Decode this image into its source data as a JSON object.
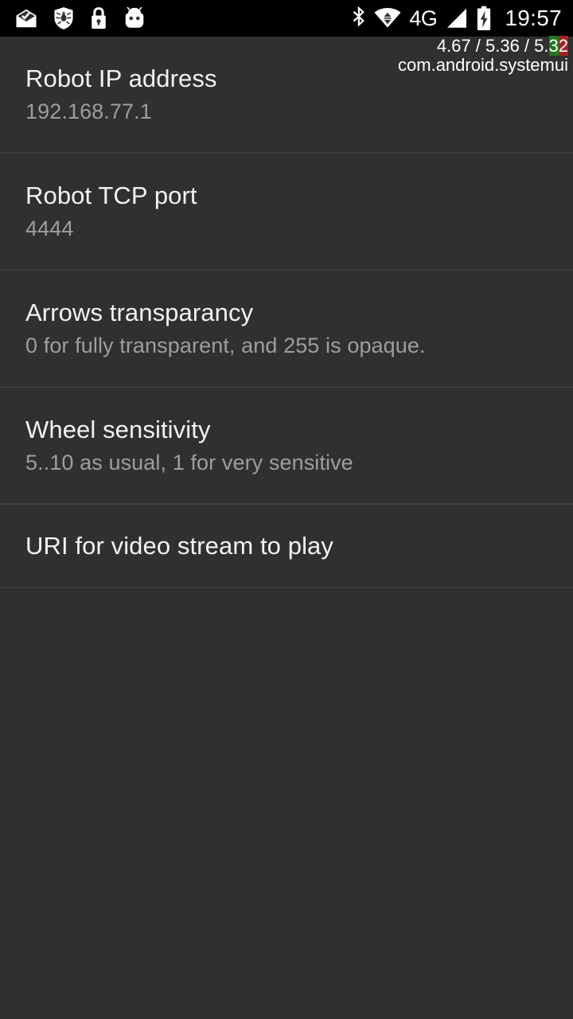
{
  "statusbar": {
    "left_icons": [
      {
        "name": "email-inbox-icon",
        "label": "Email"
      },
      {
        "name": "shield-antivirus-icon",
        "label": "Dr.Web antivirus"
      },
      {
        "name": "lock-icon",
        "label": "Screen lock"
      },
      {
        "name": "android-head-icon",
        "label": "Android"
      }
    ],
    "right_icons": [
      {
        "name": "bluetooth-icon",
        "label": "Bluetooth"
      },
      {
        "name": "wifi-icon",
        "label": "Wi-Fi"
      }
    ],
    "network_type": "4G",
    "signal_icon": "signal-bars-icon",
    "battery_icon": "battery-charging-icon",
    "clock": "19:57"
  },
  "overlay": {
    "load_prefix": "4.67 / 5.36 / 5.",
    "load_green": "3",
    "load_red": "2",
    "load_full": "4.67 / 5.36 / 5.32",
    "process": "com.android.systemui",
    "colors": {
      "green": "#1f7a1f",
      "red": "#a52222"
    }
  },
  "preferences": [
    {
      "title": "Robot IP address",
      "summary": "192.168.77.1"
    },
    {
      "title": "Robot TCP port",
      "summary": "4444"
    },
    {
      "title": "Arrows transparancy",
      "summary": "0 for fully transparent, and 255 is opaque."
    },
    {
      "title": "Wheel sensitivity",
      "summary": "5..10 as usual, 1 for very sensitive"
    },
    {
      "title": "URI for video stream to play",
      "summary": ""
    }
  ],
  "colors": {
    "background": "#303030",
    "statusbar_background": "#000000",
    "divider": "#3d3d3d",
    "title_text": "#f2f2f2",
    "summary_text": "#9e9e9e"
  }
}
